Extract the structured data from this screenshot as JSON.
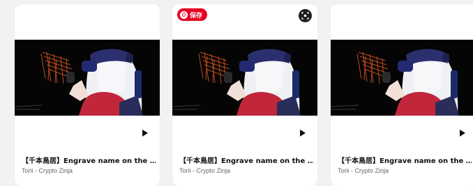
{
  "pin_save_label": "保存",
  "cards": [
    {
      "title": "【千本鳥居】Engrave name on the …",
      "subtitle": "Torii - Crypto Zinja"
    },
    {
      "title": "【千本鳥居】Engrave name on the …",
      "subtitle": "Torii - Crypto Zinja"
    },
    {
      "title": "【千本鳥居】Engrave name on the …",
      "subtitle": "Torii - Crypto Zinja"
    }
  ],
  "colors": {
    "pinterest_red": "#e60023",
    "card_bg": "#ffffff",
    "page_bg": "#f2f2f2"
  }
}
